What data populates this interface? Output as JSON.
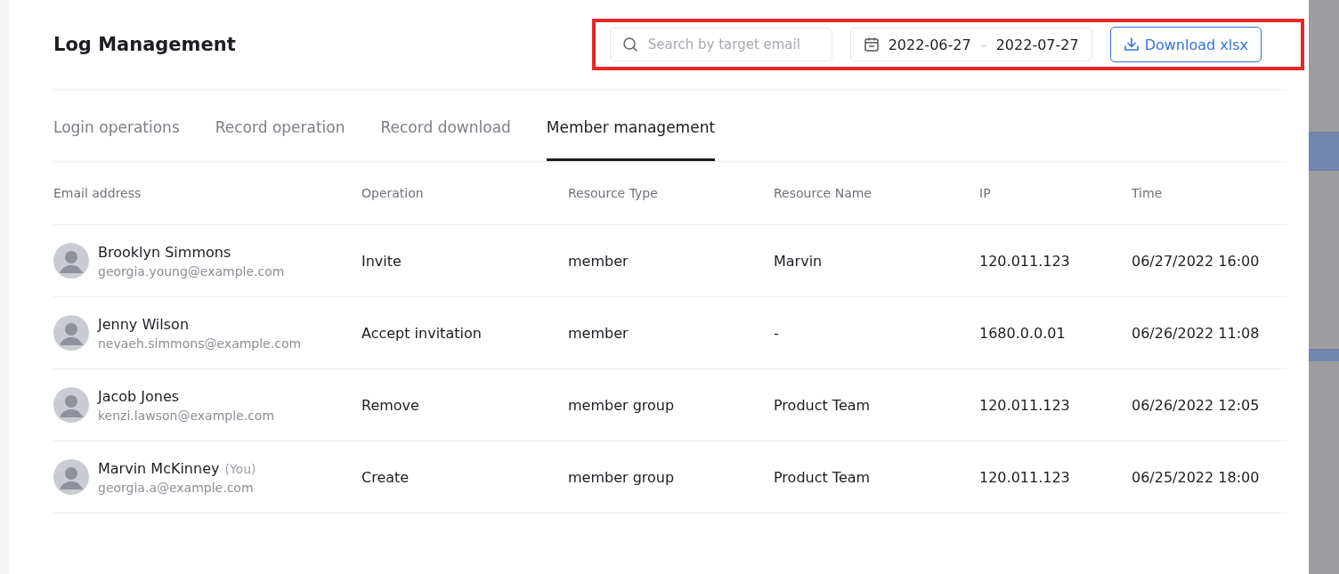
{
  "title": "Log Management",
  "search": {
    "placeholder": "Search by target email"
  },
  "date_range": {
    "start": "2022-06-27",
    "separator": "–",
    "end": "2022-07-27"
  },
  "download_button": "Download xlsx",
  "tabs": [
    {
      "label": "Login operations",
      "selected": false
    },
    {
      "label": "Record operation",
      "selected": false
    },
    {
      "label": "Record download",
      "selected": false
    },
    {
      "label": "Member management",
      "selected": true
    }
  ],
  "table": {
    "columns": [
      "Email address",
      "Operation",
      "Resource Type",
      "Resource Name",
      "IP",
      "Time"
    ],
    "rows": [
      {
        "name": "Brooklyn Simmons",
        "email": "georgia.young@example.com",
        "operation": "Invite",
        "resource_type": "member",
        "resource_name": "Marvin",
        "ip": "120.011.123",
        "time": "06/27/2022 16:00"
      },
      {
        "name": "Jenny Wilson",
        "email": "nevaeh.simmons@example.com",
        "operation": "Accept invitation",
        "resource_type": "member",
        "resource_name": "-",
        "ip": "1680.0.0.01",
        "time": "06/26/2022 11:08"
      },
      {
        "name": "Jacob Jones",
        "email": "kenzi.lawson@example.com",
        "operation": "Remove",
        "resource_type": "member group",
        "resource_name": "Product Team",
        "ip": "120.011.123",
        "time": "06/26/2022 12:05"
      },
      {
        "name": "Marvin McKinney",
        "suffix": "(You)",
        "email": "georgia.a@example.com",
        "operation": "Create",
        "resource_type": "member group",
        "resource_name": "Product Team",
        "ip": "120.011.123",
        "time": "06/25/2022 18:00"
      }
    ]
  }
}
